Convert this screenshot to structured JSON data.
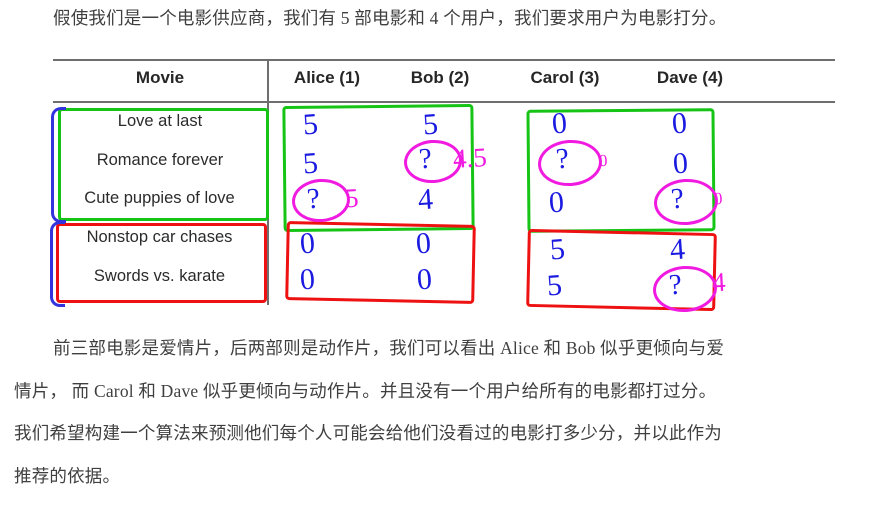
{
  "intro_paragraph": "假使我们是一个电影供应商，我们有 5 部电影和 4 个用户，我们要求用户为电影打分。",
  "body_paragraph": {
    "line1": "前三部电影是爱情片，后两部则是动作片，我们可以看出 Alice 和 Bob 似乎更倾向与爱",
    "line2": "情片， 而 Carol 和 Dave 似乎更倾向与动作片。并且没有一个用户给所有的电影都打过分。",
    "line3": "我们希望构建一个算法来预测他们每个人可能会给他们没看过的电影打多少分，并以此作为",
    "line4": "推荐的依据。"
  },
  "table": {
    "headers": {
      "movie": "Movie",
      "alice": "Alice (1)",
      "bob": "Bob (2)",
      "carol": "Carol (3)",
      "dave": "Dave (4)"
    },
    "movies": [
      "Love at last",
      "Romance forever",
      "Cute puppies of love",
      "Nonstop car chases",
      "Swords vs. karate"
    ],
    "ratings": {
      "alice": [
        "5",
        "5",
        "?",
        "0",
        "0"
      ],
      "bob": [
        "5",
        "?",
        "4",
        "0",
        "0"
      ],
      "carol": [
        "0",
        "?",
        "0",
        "5",
        "5"
      ],
      "dave": [
        "0",
        "0",
        "?",
        "4",
        "?"
      ]
    },
    "predictions": {
      "alice_row3": "5",
      "bob_row2": "4.5",
      "carol_row2": "0",
      "dave_row3": "0",
      "dave_row5": "4"
    }
  },
  "colors": {
    "romance_group": "#16c416",
    "action_group": "#ee1111",
    "rating_ink": "#1a1ae0",
    "prediction_ink": "#f01ae0",
    "bracket_ink": "#3333dd",
    "rule": "#6e6e6e"
  }
}
